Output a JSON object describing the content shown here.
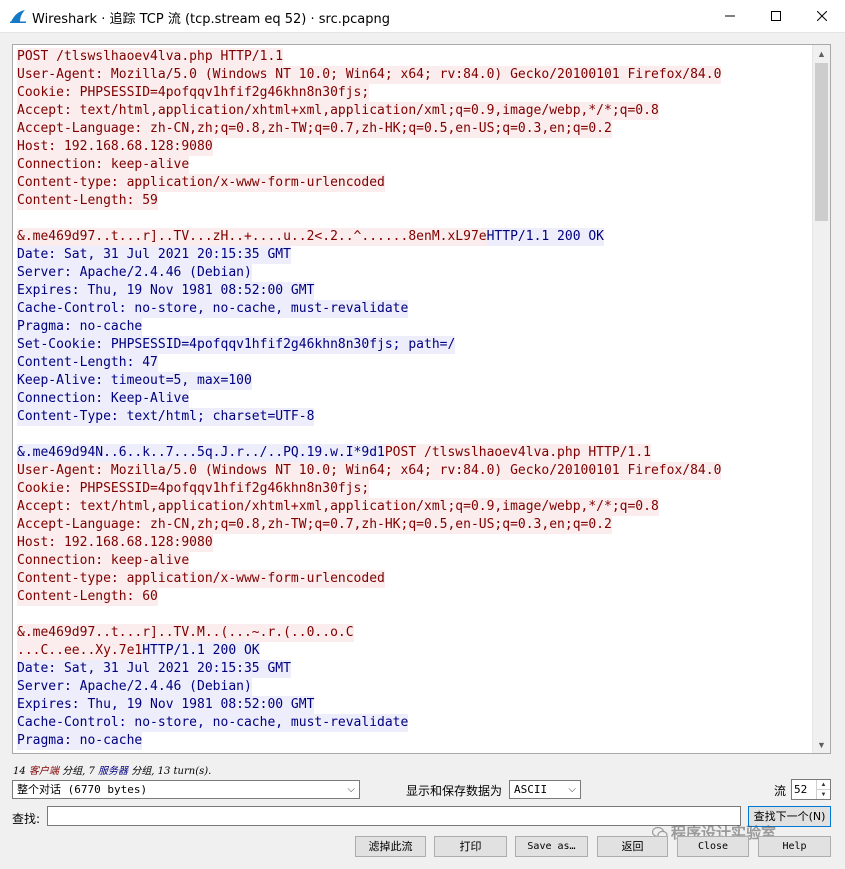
{
  "window": {
    "title": "Wireshark · 追踪 TCP 流 (tcp.stream eq 52) · src.pcapng",
    "minimize_icon": "minimize-icon",
    "maximize_icon": "maximize-icon",
    "close_icon": "close-icon"
  },
  "stream_lines": [
    [
      {
        "t": "POST /tlswslhaoev4lva.php HTTP/1.1",
        "d": "c"
      }
    ],
    [
      {
        "t": "User-Agent: Mozilla/5.0 (Windows NT 10.0; Win64; x64; rv:84.0) Gecko/20100101 Firefox/84.0",
        "d": "c"
      }
    ],
    [
      {
        "t": "Cookie: PHPSESSID=4pofqqv1hfif2g46khn8n30fjs;",
        "d": "c"
      }
    ],
    [
      {
        "t": "Accept: text/html,application/xhtml+xml,application/xml;q=0.9,image/webp,*/*;q=0.8",
        "d": "c"
      }
    ],
    [
      {
        "t": "Accept-Language: zh-CN,zh;q=0.8,zh-TW;q=0.7,zh-HK;q=0.5,en-US;q=0.3,en;q=0.2",
        "d": "c"
      }
    ],
    [
      {
        "t": "Host: 192.168.68.128:9080",
        "d": "c"
      }
    ],
    [
      {
        "t": "Connection: keep-alive",
        "d": "c"
      }
    ],
    [
      {
        "t": "Content-type: application/x-www-form-urlencoded",
        "d": "c"
      }
    ],
    [
      {
        "t": "Content-Length: 59",
        "d": "c"
      }
    ],
    [],
    [
      {
        "t": "&.me469d97..t...r]..TV...zH..+....u..2<.2..^......8enM.xL97e",
        "d": "c"
      },
      {
        "t": "HTTP/1.1 200 OK",
        "d": "s"
      }
    ],
    [
      {
        "t": "Date: Sat, 31 Jul 2021 20:15:35 GMT",
        "d": "s"
      }
    ],
    [
      {
        "t": "Server: Apache/2.4.46 (Debian)",
        "d": "s"
      }
    ],
    [
      {
        "t": "Expires: Thu, 19 Nov 1981 08:52:00 GMT",
        "d": "s"
      }
    ],
    [
      {
        "t": "Cache-Control: no-store, no-cache, must-revalidate",
        "d": "s"
      }
    ],
    [
      {
        "t": "Pragma: no-cache",
        "d": "s"
      }
    ],
    [
      {
        "t": "Set-Cookie: PHPSESSID=4pofqqv1hfif2g46khn8n30fjs; path=/",
        "d": "s"
      }
    ],
    [
      {
        "t": "Content-Length: 47",
        "d": "s"
      }
    ],
    [
      {
        "t": "Keep-Alive: timeout=5, max=100",
        "d": "s"
      }
    ],
    [
      {
        "t": "Connection: Keep-Alive",
        "d": "s"
      }
    ],
    [
      {
        "t": "Content-Type: text/html; charset=UTF-8",
        "d": "s"
      }
    ],
    [],
    [
      {
        "t": "&.me469d94N..6..k..7...5q.J.r../..PQ.19.w.I*9d1",
        "d": "s"
      },
      {
        "t": "POST /tlswslhaoev4lva.php HTTP/1.1",
        "d": "c"
      }
    ],
    [
      {
        "t": "User-Agent: Mozilla/5.0 (Windows NT 10.0; Win64; x64; rv:84.0) Gecko/20100101 Firefox/84.0",
        "d": "c"
      }
    ],
    [
      {
        "t": "Cookie: PHPSESSID=4pofqqv1hfif2g46khn8n30fjs;",
        "d": "c"
      }
    ],
    [
      {
        "t": "Accept: text/html,application/xhtml+xml,application/xml;q=0.9,image/webp,*/*;q=0.8",
        "d": "c"
      }
    ],
    [
      {
        "t": "Accept-Language: zh-CN,zh;q=0.8,zh-TW;q=0.7,zh-HK;q=0.5,en-US;q=0.3,en;q=0.2",
        "d": "c"
      }
    ],
    [
      {
        "t": "Host: 192.168.68.128:9080",
        "d": "c"
      }
    ],
    [
      {
        "t": "Connection: keep-alive",
        "d": "c"
      }
    ],
    [
      {
        "t": "Content-type: application/x-www-form-urlencoded",
        "d": "c"
      }
    ],
    [
      {
        "t": "Content-Length: 60",
        "d": "c"
      }
    ],
    [],
    [
      {
        "t": "&.me469d97..t...r]..TV.M..(...~.r.(..0..o.C",
        "d": "c"
      }
    ],
    [
      {
        "t": "...C..ee..Xy.7e1",
        "d": "c"
      },
      {
        "t": "HTTP/1.1 200 OK",
        "d": "s"
      }
    ],
    [
      {
        "t": "Date: Sat, 31 Jul 2021 20:15:35 GMT",
        "d": "s"
      }
    ],
    [
      {
        "t": "Server: Apache/2.4.46 (Debian)",
        "d": "s"
      }
    ],
    [
      {
        "t": "Expires: Thu, 19 Nov 1981 08:52:00 GMT",
        "d": "s"
      }
    ],
    [
      {
        "t": "Cache-Control: no-store, no-cache, must-revalidate",
        "d": "s"
      }
    ],
    [
      {
        "t": "Pragma: no-cache",
        "d": "s"
      }
    ]
  ],
  "stats": {
    "client_count": "14",
    "client_label": "客户端",
    "segments1": "分组,",
    "server_count": "7",
    "server_label": "服务器",
    "segments2": "分组,",
    "turns": "13 turn(s)."
  },
  "controls": {
    "conversation_select": "整个对话 (6770 bytes)",
    "show_as_label": "显示和保存数据为",
    "format_select": "ASCII",
    "stream_label": "流",
    "stream_number": "52",
    "find_label": "查找:",
    "find_value": "",
    "find_next": "查找下一个(N)"
  },
  "buttons": {
    "filter_out": "滤掉此流",
    "print": "打印",
    "save_as": "Save as…",
    "back": "返回",
    "close": "Close",
    "help": "Help"
  },
  "watermark": "程序设计实验室",
  "colors": {
    "client_fg": "#7f0000",
    "client_bg": "#fbeded",
    "server_fg": "#00007f",
    "server_bg": "#ededfb",
    "focus_border": "#0078d7"
  }
}
